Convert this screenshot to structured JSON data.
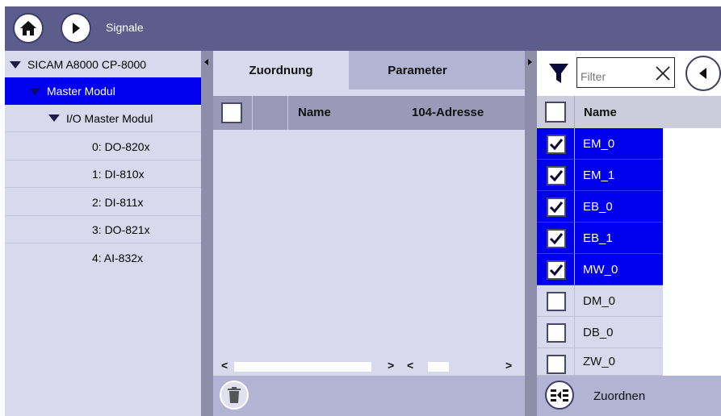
{
  "header": {
    "title": "Signale",
    "home_icon": "home-icon",
    "forward_icon": "chevron-right-icon"
  },
  "tree": {
    "items": [
      {
        "label": "SICAM A8000 CP-8000",
        "level": 0,
        "expanded": true,
        "selected": false
      },
      {
        "label": "Master Modul",
        "level": 1,
        "expanded": true,
        "selected": true
      },
      {
        "label": "I/O Master Modul",
        "level": 2,
        "expanded": true,
        "selected": false
      },
      {
        "label": "0: DO-820x",
        "level": 3,
        "selected": false
      },
      {
        "label": "1: DI-810x",
        "level": 3,
        "selected": false
      },
      {
        "label": "2: DI-811x",
        "level": 3,
        "selected": false
      },
      {
        "label": "3: DO-821x",
        "level": 3,
        "selected": false
      },
      {
        "label": "4: AI-832x",
        "level": 3,
        "selected": false
      }
    ]
  },
  "middle": {
    "tabs": [
      {
        "label": "Zuordnung",
        "active": true
      },
      {
        "label": "Parameter",
        "active": false
      }
    ],
    "columns": [
      "Name",
      "104-Adresse"
    ],
    "scroll_left": "<",
    "scroll_right": ">",
    "delete_icon": "trash-icon"
  },
  "right": {
    "filter_placeholder": "Filter",
    "column": "Name",
    "items": [
      {
        "name": "EM_0",
        "checked": true
      },
      {
        "name": "EM_1",
        "checked": true
      },
      {
        "name": "EB_0",
        "checked": true
      },
      {
        "name": "EB_1",
        "checked": true
      },
      {
        "name": "MW_0",
        "checked": true
      },
      {
        "name": "DM_0",
        "checked": false
      },
      {
        "name": "DB_0",
        "checked": false
      },
      {
        "name": "ZW_0",
        "checked": false
      }
    ],
    "assign_label": "Zuordnen"
  },
  "colors": {
    "header_bg": "#5d5d8d",
    "selected_bg": "#0000ee",
    "panel_bg": "#d9d9ee"
  }
}
